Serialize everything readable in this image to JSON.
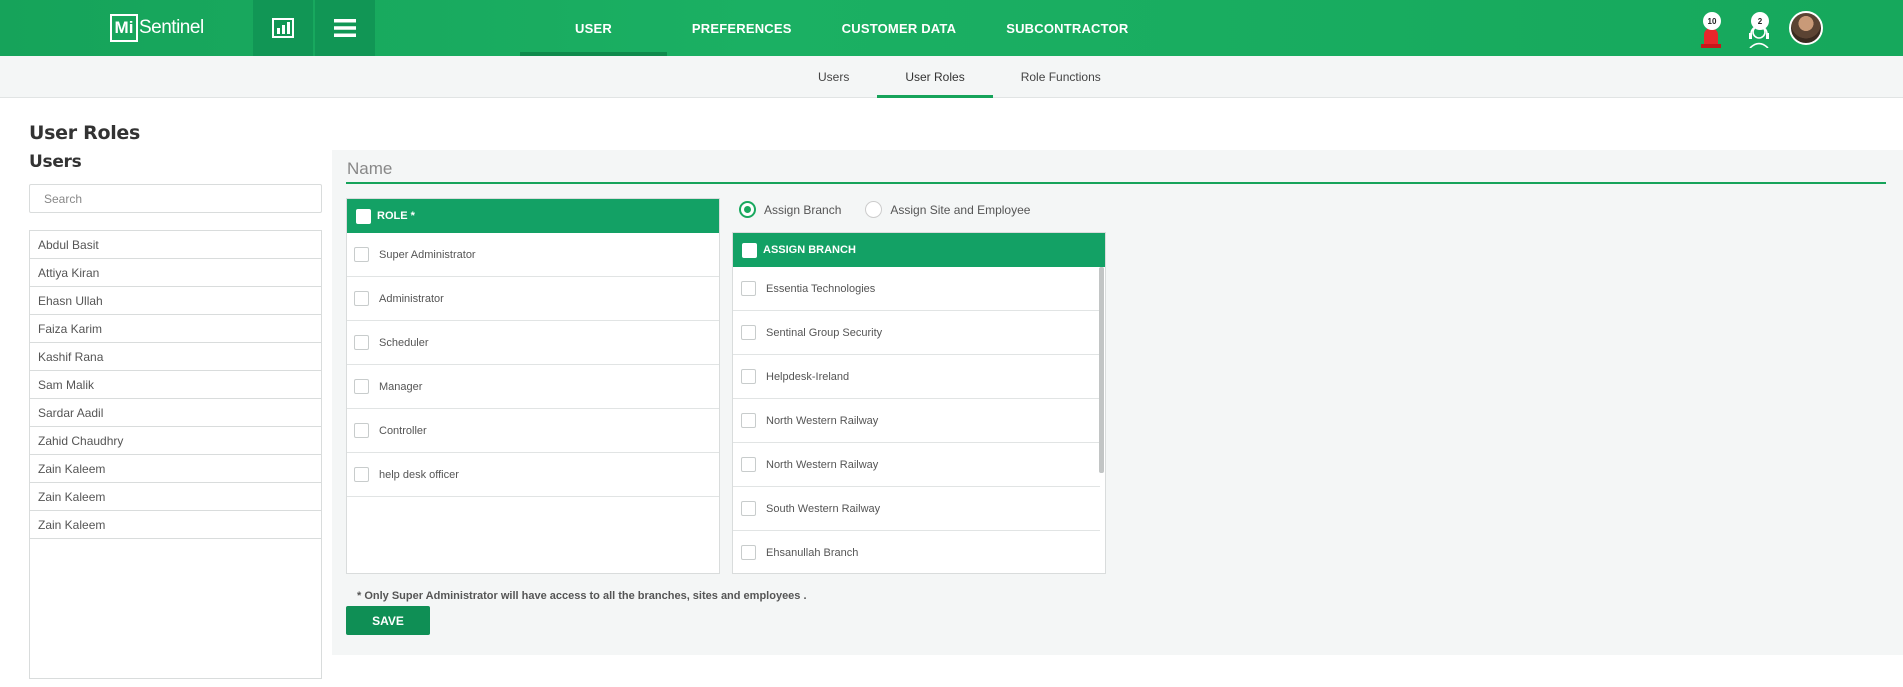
{
  "brand": {
    "logo_mark": "Mi",
    "logo_text": "Sentinel"
  },
  "topnav": {
    "items": [
      {
        "label": "USER",
        "active": true
      },
      {
        "label": "PREFERENCES",
        "active": false
      },
      {
        "label": "CUSTOMER DATA",
        "active": false
      },
      {
        "label": "SUBCONTRACTOR",
        "active": false
      }
    ]
  },
  "header_icons": {
    "alarm_badge": "10",
    "support_badge": "2"
  },
  "subnav": {
    "items": [
      {
        "label": "Users",
        "active": false
      },
      {
        "label": "User Roles",
        "active": true
      },
      {
        "label": "Role Functions",
        "active": false
      }
    ]
  },
  "page": {
    "title": "User Roles",
    "users_heading": "Users",
    "search_placeholder": "Search"
  },
  "users": [
    "Abdul Basit",
    "Attiya Kiran",
    "Ehasn Ullah",
    "Faiza Karim",
    "Kashif Rana",
    "Sam Malik",
    "Sardar Aadil",
    "Zahid Chaudhry",
    "Zain Kaleem",
    "Zain Kaleem",
    "Zain Kaleem"
  ],
  "form": {
    "name_placeholder": "Name",
    "role_header": "ROLE *",
    "roles": [
      "Super Administrator",
      "Administrator",
      "Scheduler",
      "Manager",
      "Controller",
      "help desk officer"
    ],
    "assign_options": [
      {
        "label": "Assign Branch",
        "selected": true
      },
      {
        "label": "Assign Site and Employee",
        "selected": false
      }
    ],
    "branch_header": "ASSIGN BRANCH",
    "branches": [
      "Essentia Technologies",
      "Sentinal Group Security",
      "Helpdesk-Ireland",
      "North Western Railway",
      "North Western Railway",
      "South Western Railway",
      "Ehsanullah Branch"
    ],
    "note": "* Only Super Administrator will have access to all the branches, sites and employees .",
    "save_label": "SAVE"
  },
  "colors": {
    "brand_green": "#16a35a",
    "table_header": "#13a165",
    "save_button": "#0f8f55"
  }
}
